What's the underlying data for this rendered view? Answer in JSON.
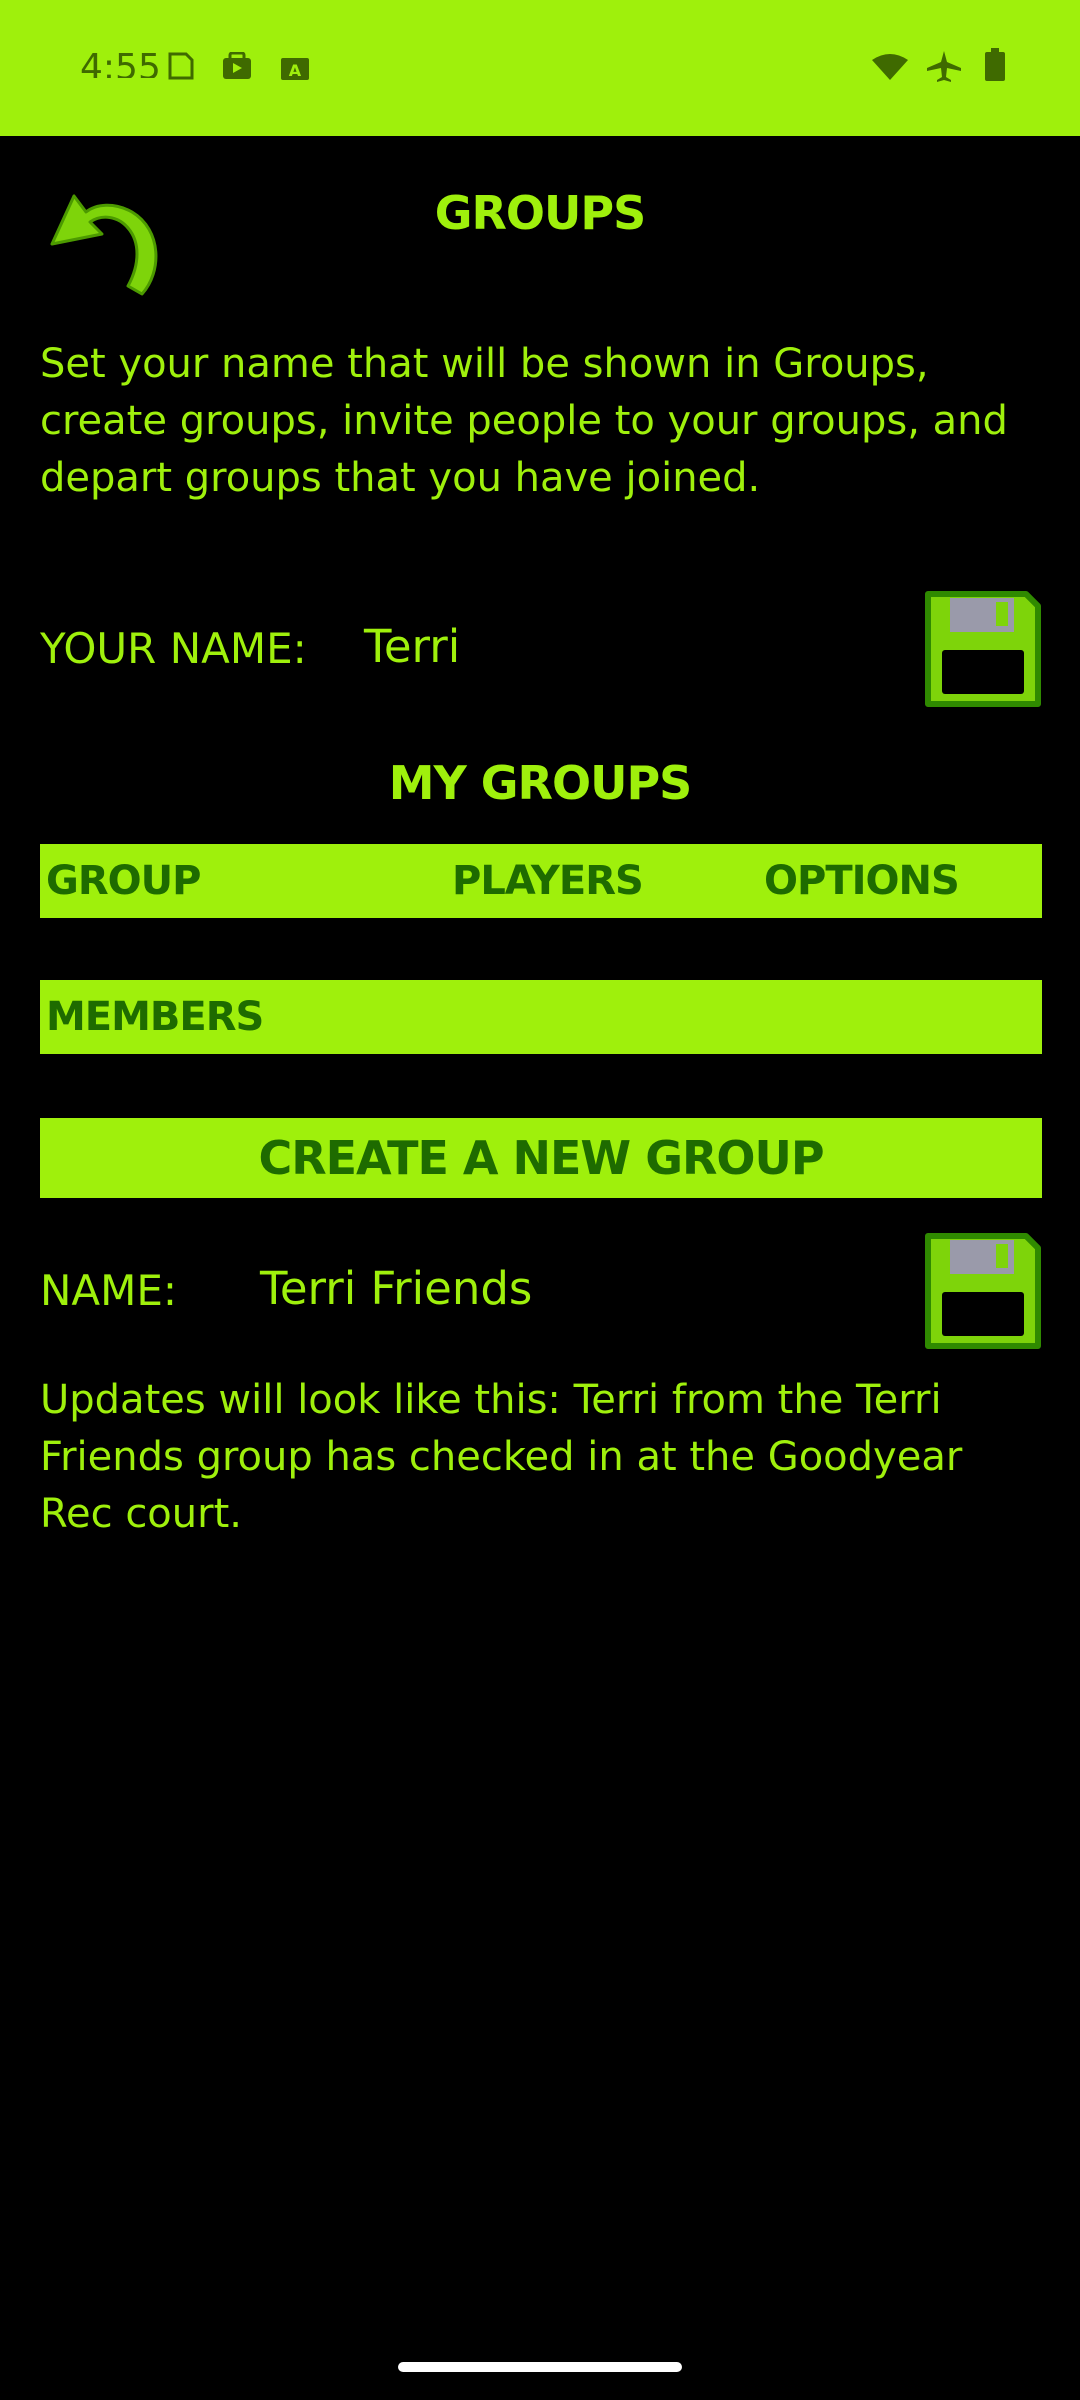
{
  "status_bar": {
    "time": "4:55"
  },
  "header": {
    "title": "GROUPS"
  },
  "description": "Set your name that will be shown in Groups, create groups, invite people to your groups, and depart groups that you have joined.",
  "your_name": {
    "label": "YOUR NAME:",
    "value": "Terri"
  },
  "my_groups": {
    "heading": "MY GROUPS",
    "columns": [
      "GROUP",
      "PLAYERS",
      "OPTIONS"
    ],
    "members_label": "MEMBERS"
  },
  "create_group": {
    "button_label": "CREATE A NEW GROUP",
    "name_label": "NAME:",
    "name_value": "Terri Friends",
    "updates_note": "Updates will look like this: Terri from the Terri Friends group has checked in at the Goodyear Rec court."
  },
  "colors": {
    "accent": "#9FF00C",
    "dark_accent": "#1E6B00",
    "background": "#000000"
  }
}
